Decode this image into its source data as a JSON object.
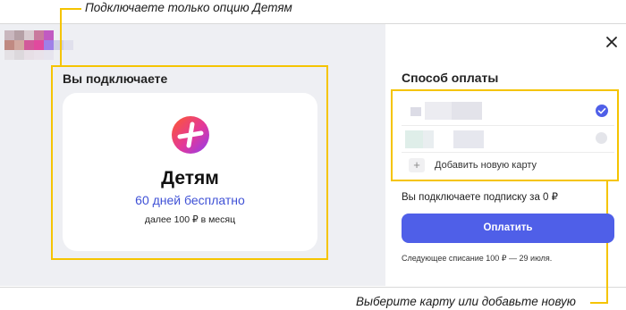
{
  "annotations": {
    "top": "Подключаете только опцию Детям",
    "bottom": "Выберите карту или добавьте новую"
  },
  "left_panel": {
    "heading": "Вы подключаете",
    "product": {
      "title": "Детям",
      "offer": "60 дней бесплатно",
      "price_after": "далее 100 ₽ в месяц",
      "icon": "plus-logo-icon"
    }
  },
  "right_panel": {
    "close_icon": "close-icon",
    "heading": "Способ оплаты",
    "cards": [
      {
        "label": "",
        "selected": true
      },
      {
        "label": "",
        "selected": false
      }
    ],
    "add_card_label": "Добавить новую карту",
    "subscription_text": "Вы подключаете подписку за 0 ₽",
    "pay_button": "Оплатить",
    "next_charge": "Следующее списание 100 ₽ — 29 июля."
  },
  "colors": {
    "accent": "#4f5fe8",
    "highlight": "#f5c400",
    "offer_text": "#3f51d6",
    "left_bg": "#eeeff3"
  }
}
